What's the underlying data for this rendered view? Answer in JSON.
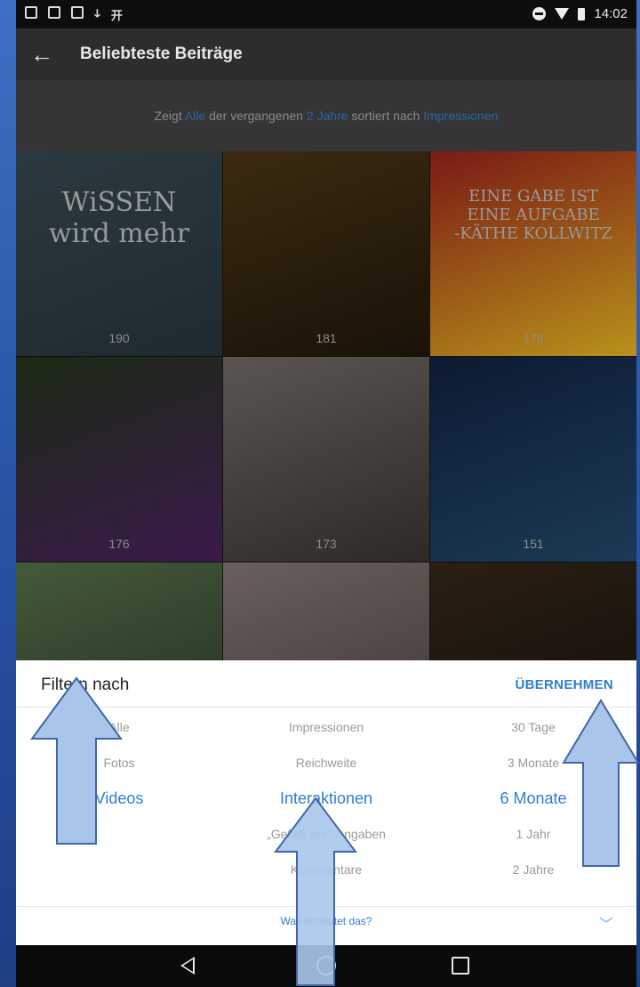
{
  "status_bar": {
    "time": "14:02",
    "left_text": "开"
  },
  "app_bar": {
    "back_icon": "arrow-left-icon",
    "title": "Beliebteste Beiträge"
  },
  "subtitle": {
    "prefix": "Zeigt ",
    "type": "Alle",
    "middle": " der vergangenen ",
    "period": "2 Jahre",
    "suffix": " sortiert nach ",
    "metric": "Impressionen"
  },
  "grid": {
    "tiles": [
      {
        "count": "190",
        "quote": "WiSSEN\nwird mehr",
        "colors": [
          "#2b3a40",
          "#1f2a30"
        ]
      },
      {
        "count": "181",
        "colors": [
          "#3a2a10",
          "#1a1208"
        ]
      },
      {
        "count": "178",
        "quote": "EINE GABE IST\nEINE AUFGABE\n-KÄTHE KOLLWITZ",
        "colors": [
          "#7a1a15",
          "#b8921a"
        ]
      },
      {
        "count": "176",
        "colors": [
          "#1b2a14",
          "#3a1a4a"
        ]
      },
      {
        "count": "173",
        "colors": [
          "#5a5550",
          "#2c2a26"
        ]
      },
      {
        "count": "151",
        "colors": [
          "#0d1a33",
          "#1b3a55"
        ]
      },
      {
        "count": "",
        "colors": [
          "#445a3a",
          "#222b20"
        ]
      },
      {
        "count": "",
        "colors": [
          "#6a5f5c",
          "#3a3534"
        ]
      },
      {
        "count": "",
        "colors": [
          "#2a1f15",
          "#120d08"
        ]
      }
    ]
  },
  "sheet": {
    "title": "Filtern nach",
    "apply_label": "ÜBERNEHMEN",
    "columns": {
      "type": [
        "Alle",
        "Fotos",
        "Videos"
      ],
      "metric": [
        "Impressionen",
        "Reichweite",
        "Interaktionen",
        "„Gefällt mir“-Angaben",
        "Kommentare"
      ],
      "period": [
        "30 Tage",
        "3 Monate",
        "6 Monate",
        "1 Jahr",
        "2 Jahre"
      ]
    },
    "help_link": "Was bedeutet das?",
    "accent_color": "#2e7ed3"
  }
}
